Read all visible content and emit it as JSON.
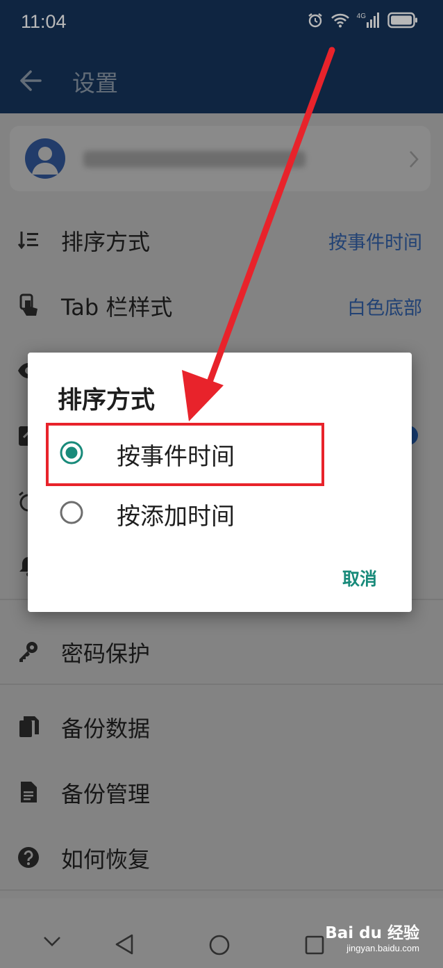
{
  "status_bar": {
    "time": "11:04",
    "network": "4G"
  },
  "app_bar": {
    "title": "设置"
  },
  "settings": [
    {
      "label": "排序方式",
      "value": "按事件时间",
      "icon": "sort-icon"
    },
    {
      "label": "Tab 栏样式",
      "value": "白色底部",
      "icon": "touch-icon"
    },
    {
      "label": "",
      "value": "",
      "icon": "eye-icon"
    },
    {
      "label": "",
      "value": "",
      "icon": "widget-icon"
    },
    {
      "label": "",
      "value": "",
      "icon": "alarm-icon"
    },
    {
      "label": "",
      "value": "",
      "icon": "bell-icon"
    },
    {
      "label": "密码保护",
      "value": "",
      "icon": "key-icon"
    },
    {
      "label": "备份数据",
      "value": "",
      "icon": "copy-icon"
    },
    {
      "label": "备份管理",
      "value": "",
      "icon": "document-icon"
    },
    {
      "label": "如何恢复",
      "value": "",
      "icon": "help-icon"
    }
  ],
  "dialog": {
    "title": "排序方式",
    "options": [
      {
        "label": "按事件时间",
        "selected": true
      },
      {
        "label": "按添加时间",
        "selected": false
      }
    ],
    "cancel_label": "取消"
  },
  "colors": {
    "app_bar": "#15345b",
    "accent_teal": "#188a7a",
    "value_blue": "#3f7bd6",
    "annotation_red": "#e8232b"
  },
  "watermark": {
    "title": "Bai du 经验",
    "url": "jingyan.baidu.com"
  }
}
